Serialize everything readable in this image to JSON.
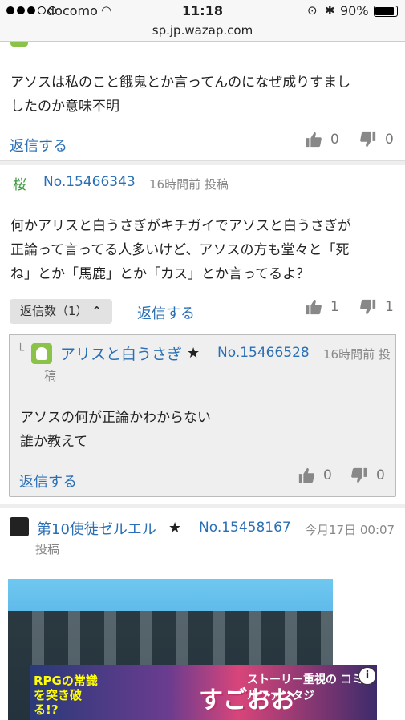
{
  "status": {
    "carrier": "docomo",
    "time": "11:18",
    "battery": "90%",
    "battery_level": 0.9
  },
  "url": "sp.jp.wazap.com",
  "post1": {
    "body_lines": [
      "アソスは私のこと餓鬼とか言ってんのになぜ成りすまし",
      "したのか意味不明"
    ],
    "reply": "返信する",
    "likes": "0",
    "dislikes": "0"
  },
  "post2": {
    "author": "桜",
    "no": "No.15466343",
    "time": "16時間前 投稿",
    "body_lines": [
      "何かアリスと白うさぎがキチガイでアソスと白うさぎが",
      "正論って言ってる人多いけど、アソスの方も堂々と「死",
      "ね」とか「馬鹿」とか「カス」とか言ってるよ？"
    ],
    "replycount": "返信数（1）",
    "reply": "返信する",
    "likes": "1",
    "dislikes": "1"
  },
  "reply1": {
    "author": "アリスと白うさぎ",
    "no": "No.15466528",
    "time_a": "16時間前 投",
    "time_b": "稿",
    "body_lines": [
      "アソスの何が正論かわからない",
      "誰か教えて"
    ],
    "reply": "返信する",
    "likes": "0",
    "dislikes": "0"
  },
  "post3": {
    "author": "第10使徒ゼルエル",
    "no": "No.15458167",
    "time_a": "今月17日 00:07",
    "time_b": "投稿"
  },
  "banner": {
    "t1": "RPGの常識を突き破る!?",
    "t2": "すごおお",
    "t3": "ストーリー重視の コミカルファンタジ",
    "info": "i"
  }
}
